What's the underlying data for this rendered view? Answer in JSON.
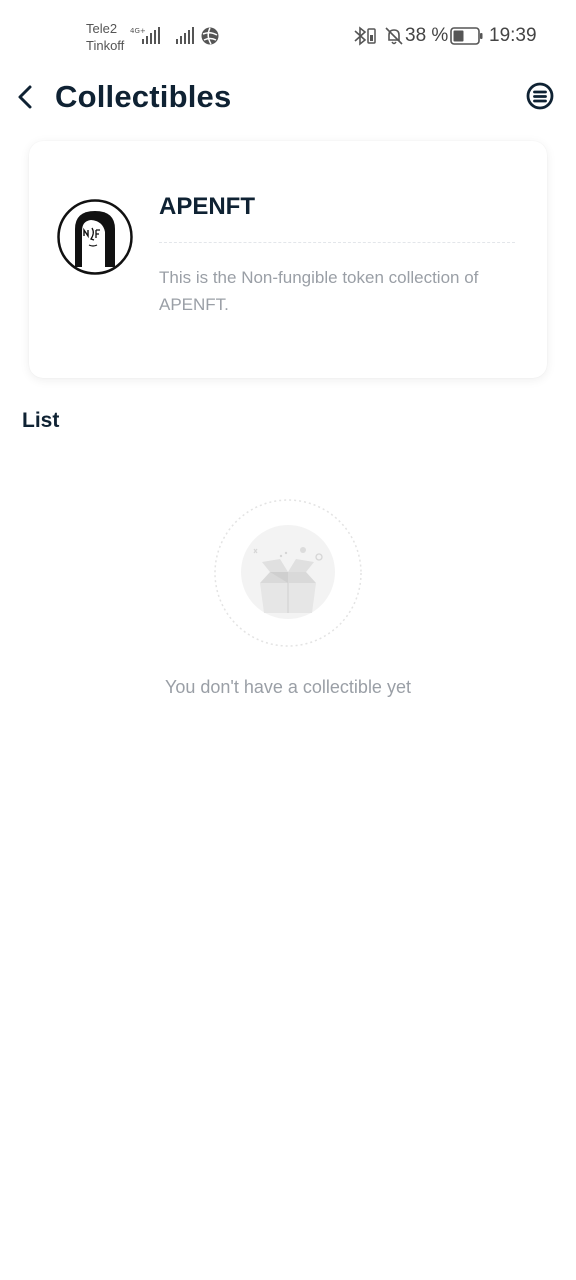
{
  "status_bar": {
    "carrier1": "Tele2",
    "carrier2": "Tinkoff",
    "network_type": "4G+",
    "battery_percent": "38 %",
    "time": "19:39"
  },
  "header": {
    "title": "Collectibles",
    "back_icon": "back-arrow-icon",
    "menu_icon": "menu-icon"
  },
  "collection": {
    "name": "APENFT",
    "description": "This is the Non-fungible token collection of APENFT.",
    "avatar_icon": "apenft-logo"
  },
  "list": {
    "heading": "List",
    "empty_message": "You don't have a collectible yet",
    "empty_icon": "empty-box-icon"
  },
  "colors": {
    "title_text": "#0f2233",
    "secondary_text": "#9a9fa6",
    "background": "#ffffff"
  }
}
